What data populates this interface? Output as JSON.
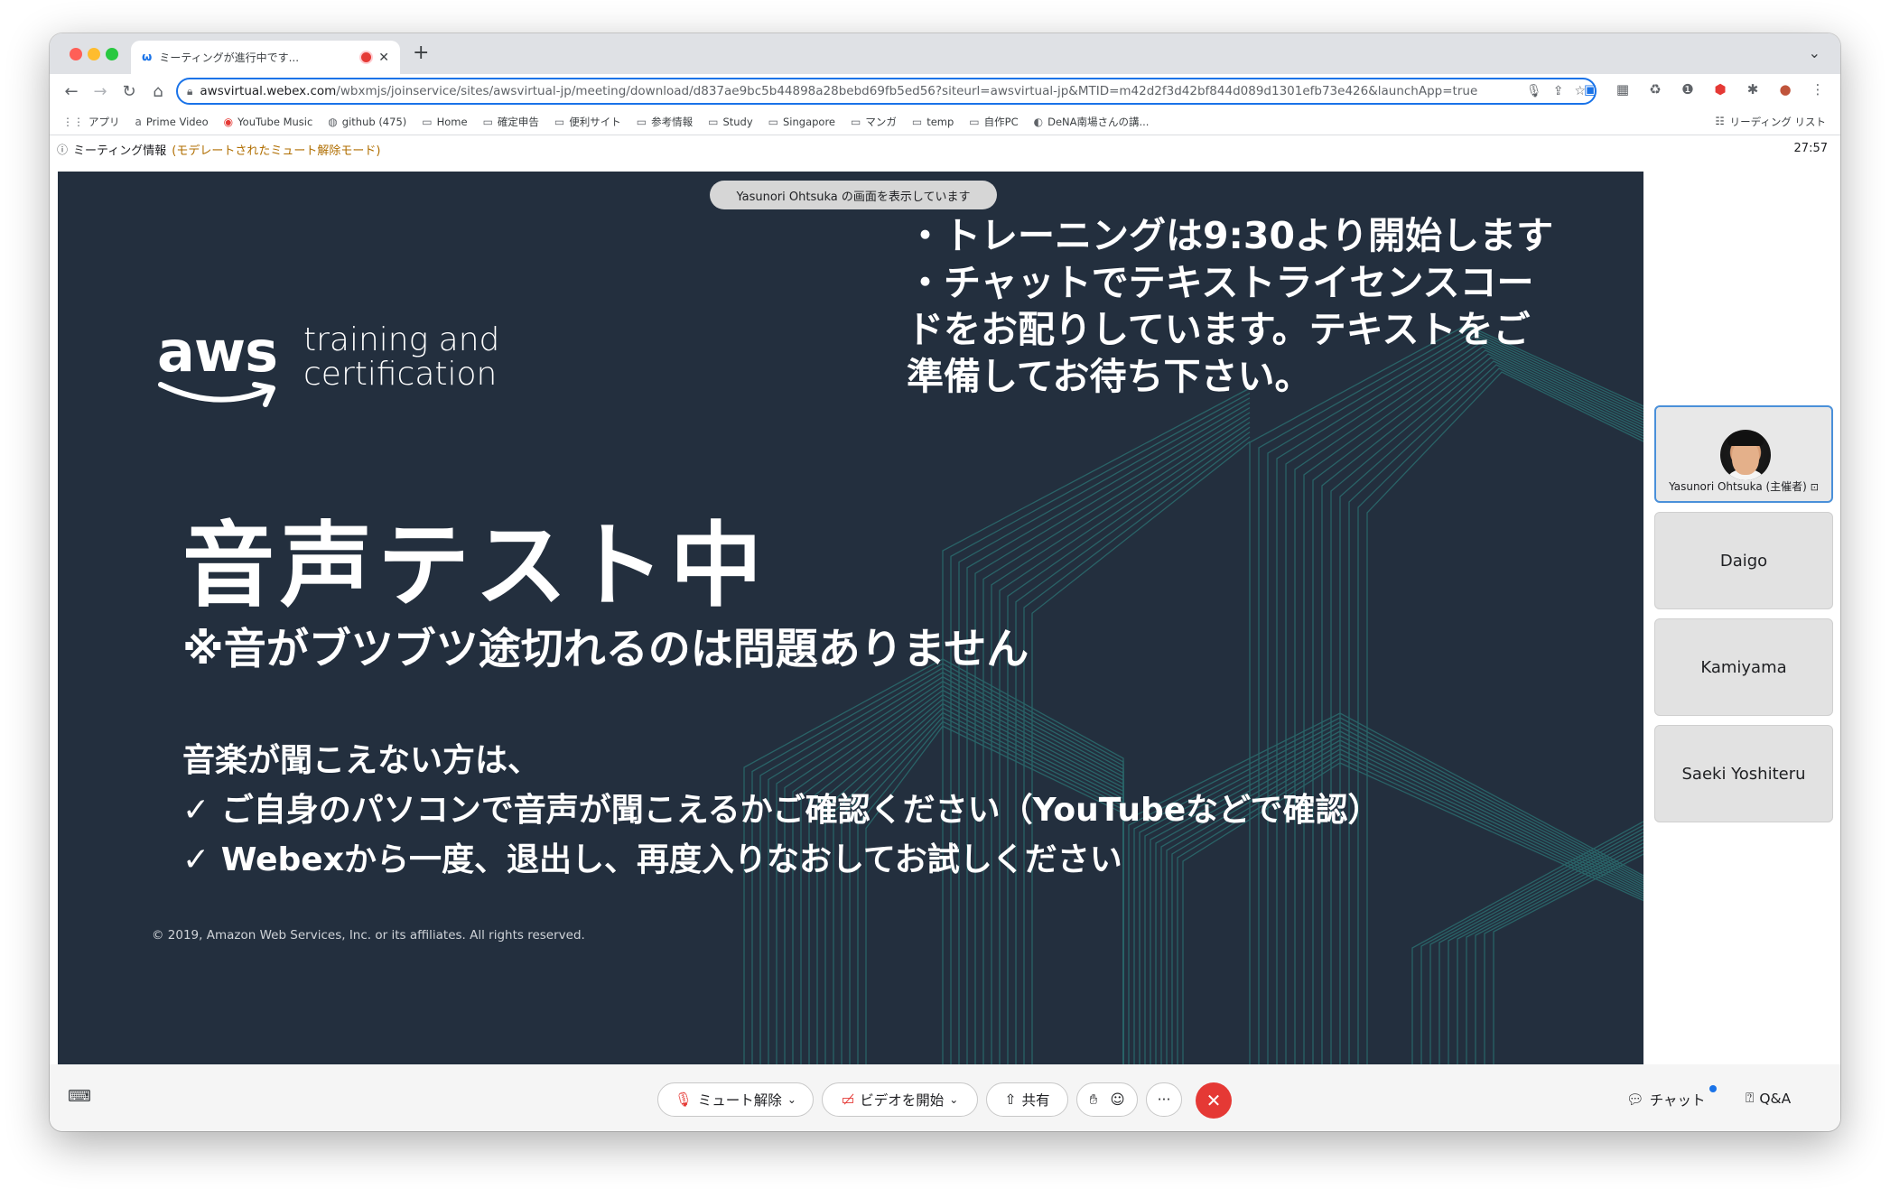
{
  "browser": {
    "tab_title": "ミーティングが進行中です...",
    "new_tab_label": "+",
    "url_domain": "awsvirtual.webex.com",
    "url_path": "/wbxmjs/joinservice/sites/awsvirtual-jp/meeting/download/d837ae9bc5b44898a28bebd69fb5ed56?siteurl=awsvirtual-jp&MTID=m42d2f3d42bf844d089d1301efb73e426&launchApp=true",
    "bookmarks": [
      {
        "label": "アプリ",
        "icon": "apps-grid-icon"
      },
      {
        "label": "Prime Video",
        "icon": "amazon-icon"
      },
      {
        "label": "YouTube Music",
        "icon": "youtube-music-icon"
      },
      {
        "label": "github (475)",
        "icon": "github-icon"
      },
      {
        "label": "Home",
        "icon": "folder-icon"
      },
      {
        "label": "確定申告",
        "icon": "folder-icon"
      },
      {
        "label": "便利サイト",
        "icon": "folder-icon"
      },
      {
        "label": "参考情報",
        "icon": "folder-icon"
      },
      {
        "label": "Study",
        "icon": "folder-icon"
      },
      {
        "label": "Singapore",
        "icon": "folder-icon"
      },
      {
        "label": "マンガ",
        "icon": "folder-icon"
      },
      {
        "label": "temp",
        "icon": "folder-icon"
      },
      {
        "label": "自作PC",
        "icon": "folder-icon"
      },
      {
        "label": "DeNA南場さんの講...",
        "icon": "globe-icon"
      }
    ],
    "reading_list": "リーディング リスト"
  },
  "meeting": {
    "info_label": "ミーティング情報",
    "moderated_label": "(モデレートされたミュート解除モード)",
    "elapsed": "27:57",
    "share_banner": "Yasunori Ohtsuka の画面を表示しています"
  },
  "slide": {
    "logo_word": "aws",
    "logo_sub1": "training and",
    "logo_sub2": "certification",
    "notice_lines": [
      "・トレーニングは9:30より開始します",
      "・チャットでテキストライセンスコー",
      "ドをお配りしています。テキストをご",
      "準備してお待ち下さい。"
    ],
    "title": "音声テスト中",
    "subtitle": "※音がブツブツ途切れるのは問題ありません",
    "para_lines": [
      "音楽が聞こえない方は、",
      "✓ ご自身のパソコンで音声が聞こえるかご確認ください（YouTubeなどで確認）",
      "✓ Webexから一度、退出し、再度入りなおしてお試しください"
    ],
    "copyright": "© 2019, Amazon Web Services, Inc. or its affiliates. All rights reserved."
  },
  "participants": [
    {
      "name": "Yasunori Ohtsuka (主催者)",
      "active": true
    },
    {
      "name": "Daigo"
    },
    {
      "name": "Kamiyama"
    },
    {
      "name": "Saeki Yoshiteru"
    }
  ],
  "controls": {
    "unmute": "ミュート解除",
    "start_video": "ビデオを開始",
    "share": "共有",
    "more": "···",
    "chat": "チャット",
    "qa": "Q&A"
  },
  "colors": {
    "slide_bg": "#232f3e",
    "end_call": "#e53935",
    "omnibox_focus": "#1a73e8"
  }
}
